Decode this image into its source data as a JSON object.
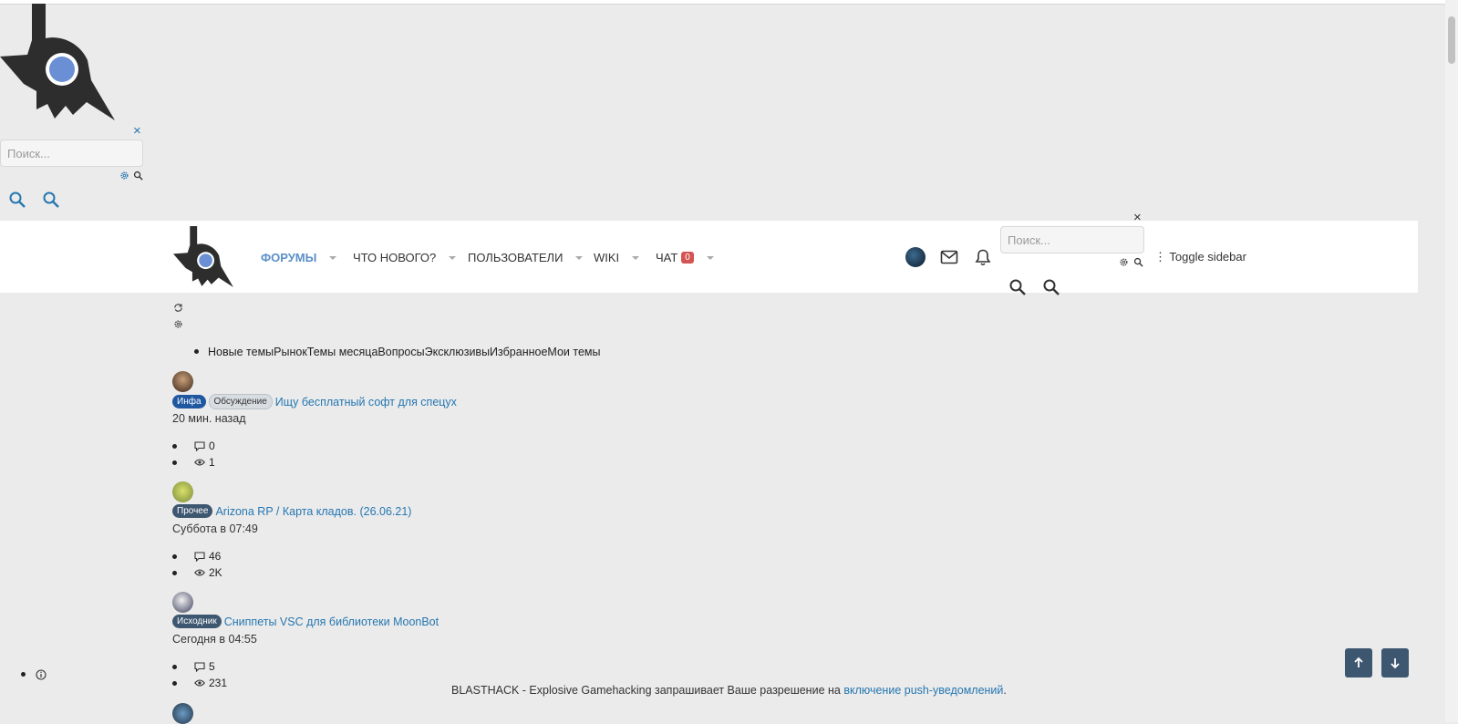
{
  "search": {
    "placeholder": "Поиск...",
    "close_glyph": "×"
  },
  "nav": {
    "items": [
      {
        "label": "ФОРУМЫ",
        "active": true
      },
      {
        "label": "ЧТО НОВОГО?"
      },
      {
        "label": "ПОЛЬЗОВАТЕЛИ"
      },
      {
        "label": "WIKI"
      },
      {
        "label": "ЧАТ",
        "badge": "0"
      }
    ],
    "toggle_sidebar": "Toggle sidebar"
  },
  "tabs_text": "Новые темыРынокТемы месяцаВопросыЭксклюзивыИзбранноеМои темы",
  "threads": [
    {
      "prefixes": [
        "Инфа",
        "Обсуждение"
      ],
      "title": "Ищу бесплатный софт для спецух",
      "time": "20 мин. назад",
      "replies": "0",
      "views": "1"
    },
    {
      "prefixes": [
        "Прочее"
      ],
      "title": "Arizona RP / Карта кладов. (26.06.21)",
      "time": "Суббота в 07:49",
      "replies": "46",
      "views": "2K"
    },
    {
      "prefixes": [
        "Исходник"
      ],
      "title": "Сниппеты VSC для библиотеки MoonBot",
      "time": "Сегодня в 04:55",
      "replies": "5",
      "views": "231"
    }
  ],
  "push": {
    "text": "BLASTHACK - Explosive Gamehacking запрашивает Ваше разрешение на ",
    "link": "включение push-уведомлений",
    "tail": "."
  },
  "icons": {
    "logo": "blasthack-logo-icon",
    "search": "search-icon",
    "settings": "gear-icon",
    "refresh": "refresh-icon",
    "mail": "mail-icon",
    "bell": "bell-icon",
    "replies": "comment-icon",
    "views": "eye-icon",
    "info": "info-icon",
    "up": "arrow-up-icon",
    "down": "arrow-down-icon"
  },
  "colors": {
    "accent": "#2577b1",
    "nav_active": "#5b8fc7",
    "button_dark": "#3e5770",
    "badge_red": "#d35452"
  }
}
